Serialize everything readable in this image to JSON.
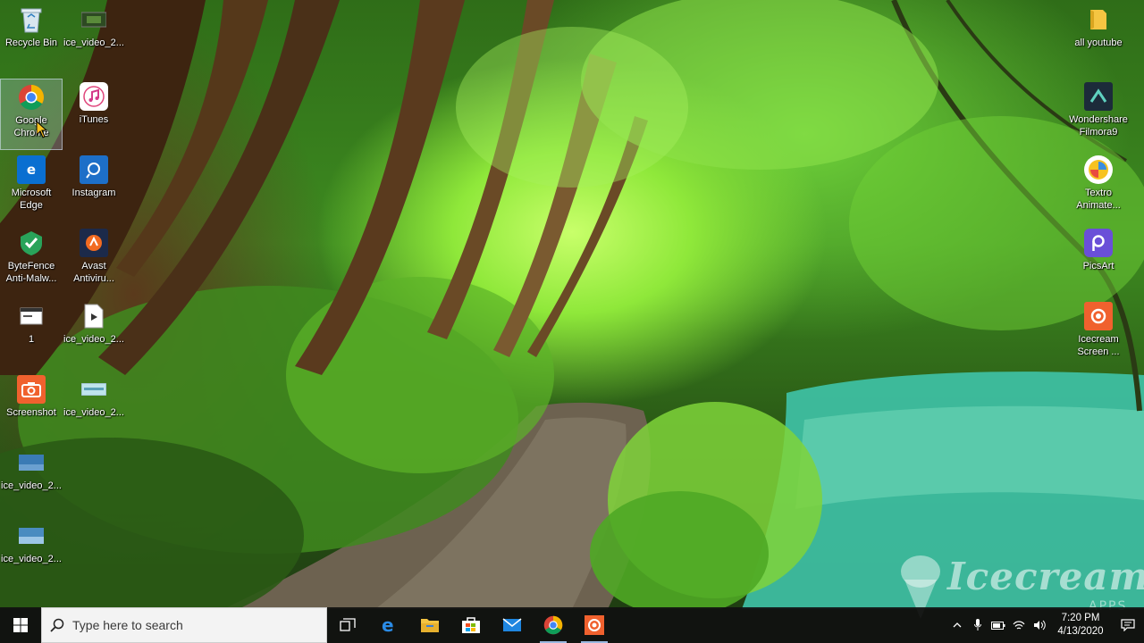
{
  "desktop": {
    "icons": [
      {
        "id": "recycle-bin",
        "label": "Recycle Bin",
        "icon": "recycle-bin-icon"
      },
      {
        "id": "ice-video-1",
        "label": "ice_video_2...",
        "icon": "video-file-icon"
      },
      {
        "id": "google-chrome",
        "label": "Google\nChrome",
        "icon": "chrome-icon",
        "selected": true
      },
      {
        "id": "itunes",
        "label": "iTunes",
        "icon": "itunes-icon"
      },
      {
        "id": "microsoft-edge",
        "label": "Microsoft\nEdge",
        "icon": "edge-icon"
      },
      {
        "id": "instagram",
        "label": "Instagram",
        "icon": "instagram-app-icon"
      },
      {
        "id": "bytefence",
        "label": "ByteFence\nAnti-Malw...",
        "icon": "bytefence-icon"
      },
      {
        "id": "avast",
        "label": "Avast\nAntiviru...",
        "icon": "avast-icon"
      },
      {
        "id": "file-1",
        "label": "1",
        "icon": "window-file-icon"
      },
      {
        "id": "ice-video-2",
        "label": "ice_video_2...",
        "icon": "video-document-icon"
      },
      {
        "id": "screenshot",
        "label": "Screenshot",
        "icon": "screenshot-icon"
      },
      {
        "id": "ice-video-3",
        "label": "ice_video_2...",
        "icon": "video-thumbnail-icon"
      },
      {
        "id": "ice-video-4",
        "label": "ice_video_2...",
        "icon": "video-thumbnail-icon"
      },
      {
        "id": "ice-video-5",
        "label": "ice_video_2...",
        "icon": "video-thumbnail-icon"
      },
      {
        "id": "all-youtube",
        "label": "all youtube",
        "icon": "folder-icon"
      },
      {
        "id": "filmora",
        "label": "Wondershare\nFilmora9",
        "icon": "filmora-icon"
      },
      {
        "id": "textro",
        "label": "Textro\nAnimate...",
        "icon": "textro-icon"
      },
      {
        "id": "picsart",
        "label": "PicsArt",
        "icon": "picsart-icon"
      },
      {
        "id": "icecream",
        "label": "Icecream\nScreen ...",
        "icon": "icecream-recorder-icon"
      }
    ]
  },
  "watermark": {
    "brand": "Icecream",
    "sub": "APPS"
  },
  "taskbar": {
    "search_placeholder": "Type here to search",
    "pinned": [
      {
        "name": "task-view",
        "icon": "task-view-icon"
      },
      {
        "name": "edge",
        "icon": "edge-icon"
      },
      {
        "name": "file-explorer",
        "icon": "folder-icon"
      },
      {
        "name": "store",
        "icon": "store-icon"
      },
      {
        "name": "mail",
        "icon": "mail-icon"
      },
      {
        "name": "chrome",
        "icon": "chrome-icon"
      },
      {
        "name": "icecream-recorder",
        "icon": "icecream-recorder-icon"
      }
    ],
    "tray": {
      "time": "7:20 PM",
      "date": "4/13/2020"
    }
  },
  "colors": {
    "taskbar": "#101010",
    "accent": "#0078d7",
    "search_bg": "#f3f3f3"
  }
}
